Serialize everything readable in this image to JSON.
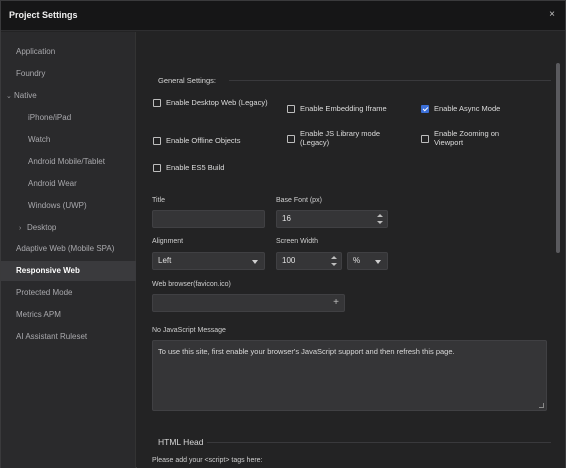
{
  "window": {
    "title": "Project Settings",
    "close_glyph": "×"
  },
  "sidebar": {
    "items": [
      {
        "label": "Application"
      },
      {
        "label": "Foundry"
      },
      {
        "label": "Native",
        "caret": "⌄"
      },
      {
        "label": "iPhone/iPad"
      },
      {
        "label": "Watch"
      },
      {
        "label": "Android Mobile/Tablet"
      },
      {
        "label": "Android Wear"
      },
      {
        "label": "Windows (UWP)"
      },
      {
        "label": "Desktop",
        "caret": "›"
      },
      {
        "label": "Adaptive Web (Mobile SPA)"
      },
      {
        "label": "Responsive Web",
        "active": true
      },
      {
        "label": "Protected Mode"
      },
      {
        "label": "Metrics APM"
      },
      {
        "label": "AI Assistant Ruleset"
      }
    ]
  },
  "general": {
    "heading": "General Settings:",
    "checkboxes": [
      {
        "label": "Enable Desktop Web (Legacy)",
        "checked": false
      },
      {
        "label": "Enable Embedding Iframe",
        "checked": false
      },
      {
        "label": "Enable Async Mode",
        "checked": true
      },
      {
        "label": "Enable Offline Objects",
        "checked": false
      },
      {
        "label": "Enable JS Library mode (Legacy)",
        "checked": false
      },
      {
        "label": "Enable Zooming on Viewport",
        "checked": false
      },
      {
        "label": "Enable ES5 Build",
        "checked": false
      }
    ]
  },
  "fields": {
    "title_label": "Title",
    "title_value": "",
    "base_font_label": "Base Font (px)",
    "base_font_value": "16",
    "alignment_label": "Alignment",
    "alignment_value": "Left",
    "screen_width_label": "Screen Width",
    "screen_width_value": "100",
    "screen_width_unit": "%",
    "favicon_label": "Web browser(favicon.ico)",
    "favicon_value": "",
    "favicon_add": "+",
    "nojs_label": "No JavaScript Message",
    "nojs_value": "To use this site, first enable your browser's JavaScript support and then refresh this page."
  },
  "html_head": {
    "heading": "HTML Head",
    "hint": "Please add your <script> tags here:"
  }
}
